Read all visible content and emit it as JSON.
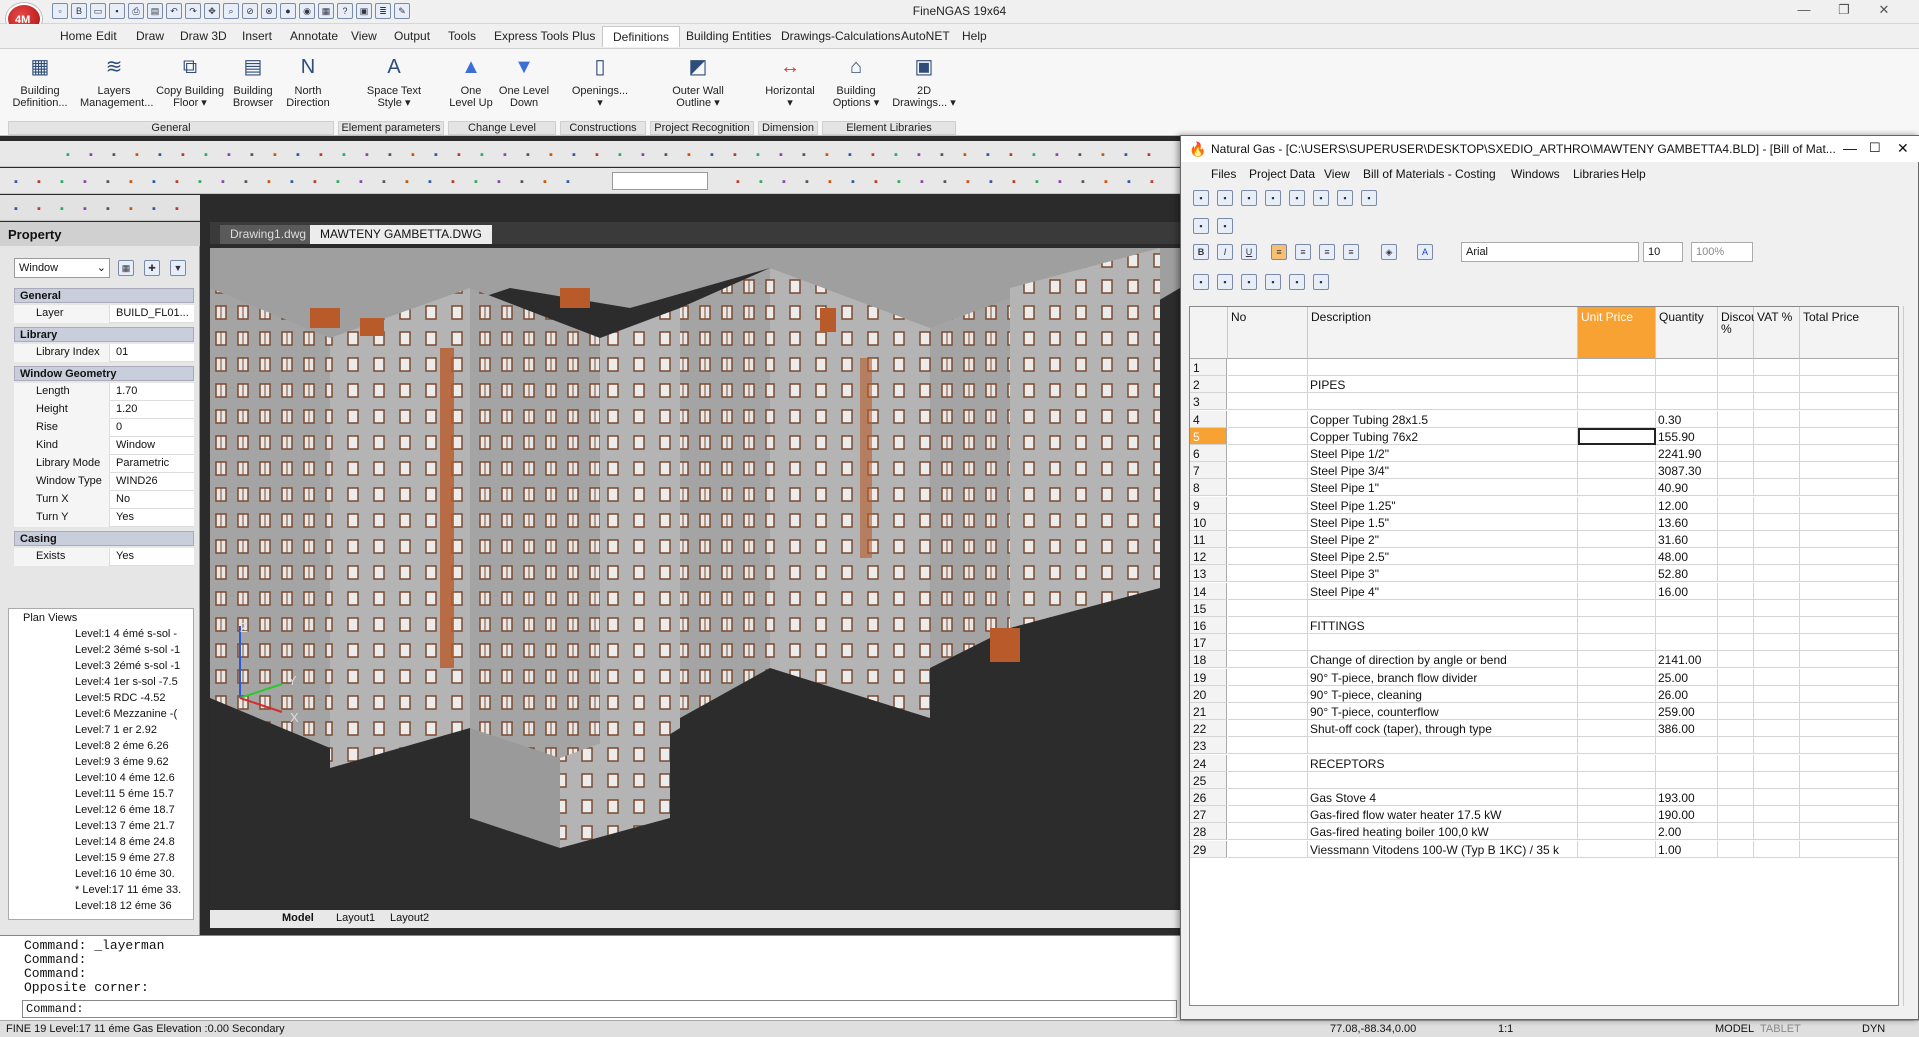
{
  "app": {
    "title": "FineNGAS 19x64",
    "logo_text": "4M"
  },
  "menu": [
    "Home",
    "Edit",
    "Draw",
    "Draw 3D",
    "Insert",
    "Annotate",
    "View",
    "Output",
    "Tools",
    "Express Tools",
    "Plus",
    "Definitions",
    "Building Entities",
    "Drawings-Calculations",
    "AutoNET",
    "Help"
  ],
  "menu_active": "Definitions",
  "ribbon": {
    "buttons": [
      {
        "label": "Building\nDefinition...",
        "icon": "building-icon"
      },
      {
        "label": "Layers\nManagement...",
        "icon": "layers-icon"
      },
      {
        "label": "Copy Building\nFloor ▾",
        "icon": "copy-floor-icon"
      },
      {
        "label": "Building\nBrowser",
        "icon": "browser-icon"
      },
      {
        "label": "North\nDirection",
        "icon": "north-icon"
      },
      {
        "label": "Space Text\nStyle ▾",
        "icon": "text-style-icon"
      },
      {
        "label": "One\nLevel Up",
        "icon": "level-up-icon"
      },
      {
        "label": "One Level\nDown",
        "icon": "level-down-icon"
      },
      {
        "label": "Openings...\n▾",
        "icon": "openings-icon"
      },
      {
        "label": "Outer Wall\nOutline ▾",
        "icon": "outer-wall-icon"
      },
      {
        "label": "Horizontal\n▾",
        "icon": "dimension-icon"
      },
      {
        "label": "Building\nOptions ▾",
        "icon": "options-icon"
      },
      {
        "label": "2D\nDrawings... ▾",
        "icon": "drawings-icon"
      }
    ],
    "groups": [
      "General",
      "Element parameters",
      "Change Level",
      "Constructions",
      "Project Recognition",
      "Dimension",
      "Element Libraries"
    ]
  },
  "property": {
    "header": "Property",
    "selector": "Window",
    "sections": [
      {
        "title": "General",
        "rows": [
          [
            "Layer",
            "BUILD_FL01..."
          ]
        ]
      },
      {
        "title": "Library",
        "rows": [
          [
            "Library Index",
            "01"
          ]
        ]
      },
      {
        "title": "Window Geometry",
        "rows": [
          [
            "Length",
            "1.70"
          ],
          [
            "Height",
            "1.20"
          ],
          [
            "Rise",
            "0"
          ],
          [
            "Kind",
            "Window"
          ],
          [
            "Library Mode",
            "Parametric"
          ],
          [
            "Window Type",
            "WIND26"
          ],
          [
            "Turn X",
            "No"
          ],
          [
            "Turn Y",
            "Yes"
          ]
        ]
      },
      {
        "title": "Casing",
        "rows": [
          [
            "Exists",
            "Yes"
          ]
        ]
      }
    ]
  },
  "tree": {
    "root": "Plan Views",
    "items": [
      "Level:1 4 émé s-sol -",
      "Level:2 3émé s-sol -1",
      "Level:3 2émé s-sol -1",
      "Level:4 1er s-sol -7.5",
      "Level:5 RDC -4.52",
      "Level:6 Mezzanine -(",
      "Level:7 1 er 2.92",
      "Level:8 2 éme 6.26",
      "Level:9 3 éme 9.62",
      "Level:10 4 éme 12.6",
      "Level:11 5 éme 15.7",
      "Level:12 6 éme 18.7",
      "Level:13 7 éme 21.7",
      "Level:14 8 éme 24.8",
      "Level:15 9 éme 27.8",
      "Level:16 10 éme 30.",
      "* Level:17 11 éme 33.",
      "Level:18 12 éme 36"
    ]
  },
  "doc_tabs": [
    "Drawing1.dwg",
    "MAWTENY GAMBETTA.DWG"
  ],
  "layout_tabs": [
    "Model",
    "Layout1",
    "Layout2"
  ],
  "axes": {
    "z": "Z",
    "y": "Y",
    "x": "X"
  },
  "command": {
    "lines": [
      "Command: _layerman",
      "Command:",
      "Command:",
      "Opposite corner:"
    ],
    "prompt": "Command:"
  },
  "status": {
    "left": "FINE 19 Level:17 11 éme Gas Elevation :0.00 Secondary",
    "coords": "77.08,-88.34,0.00",
    "scale": "1:1",
    "model": "MODEL",
    "tablet": "TABLET",
    "dyn": "DYN"
  },
  "bom": {
    "title": "Natural Gas - [C:\\USERS\\SUPERUSER\\DESKTOP\\SXEDIO_ARTHRO\\MAWTENY GAMBETTA4.BLD] - [Bill of Mat...",
    "menu": [
      "Files",
      "Project Data",
      "View",
      "Bill of Materials - Costing",
      "Windows",
      "Libraries",
      "Help"
    ],
    "font": "Arial",
    "font_size": "10",
    "zoom": "100%",
    "columns": [
      "No",
      "Description",
      "Unit Price",
      "Quantity",
      "Discount %",
      "VAT %",
      "Total Price"
    ],
    "rows": [
      [
        "1",
        "",
        ""
      ],
      [
        "2",
        "PIPES",
        ""
      ],
      [
        "3",
        "",
        ""
      ],
      [
        "4",
        "Copper Tubing 28x1.5",
        "0.30"
      ],
      [
        "5",
        "Copper Tubing 76x2",
        "155.90"
      ],
      [
        "6",
        "Steel Pipe 1/2\"",
        "2241.90"
      ],
      [
        "7",
        "Steel Pipe 3/4\"",
        "3087.30"
      ],
      [
        "8",
        "Steel Pipe 1\"",
        "40.90"
      ],
      [
        "9",
        "Steel Pipe 1.25\"",
        "12.00"
      ],
      [
        "10",
        "Steel Pipe 1.5\"",
        "13.60"
      ],
      [
        "11",
        "Steel Pipe 2\"",
        "31.60"
      ],
      [
        "12",
        "Steel Pipe 2.5\"",
        "48.00"
      ],
      [
        "13",
        "Steel Pipe 3\"",
        "52.80"
      ],
      [
        "14",
        "Steel Pipe 4\"",
        "16.00"
      ],
      [
        "15",
        "",
        ""
      ],
      [
        "16",
        "FITTINGS",
        ""
      ],
      [
        "17",
        "",
        ""
      ],
      [
        "18",
        "Change of direction by angle or bend",
        "2141.00"
      ],
      [
        "19",
        "90° T-piece, branch flow divider",
        "25.00"
      ],
      [
        "20",
        "90° T-piece, cleaning",
        "26.00"
      ],
      [
        "21",
        "90° T-piece, counterflow",
        "259.00"
      ],
      [
        "22",
        "Shut-off cock (taper), through type",
        "386.00"
      ],
      [
        "23",
        "",
        ""
      ],
      [
        "24",
        "RECEPTORS",
        ""
      ],
      [
        "25",
        "",
        ""
      ],
      [
        "26",
        "Gas Stove 4",
        "193.00"
      ],
      [
        "27",
        "Gas-fired flow water heater 17.5 kW",
        "190.00"
      ],
      [
        "28",
        "Gas-fired heating boiler 100,0 kW",
        "2.00"
      ],
      [
        "29",
        "Viessmann Vitodens 100-W (Typ B 1KC) / 35 k",
        "1.00"
      ]
    ],
    "selected_row": "5",
    "highlight_color": "#f7a233"
  },
  "colors": {
    "accent": "#f7a233",
    "viewport": "#2c2c2c",
    "building": "#9a9a9a",
    "balcony": "#b85a2a"
  }
}
